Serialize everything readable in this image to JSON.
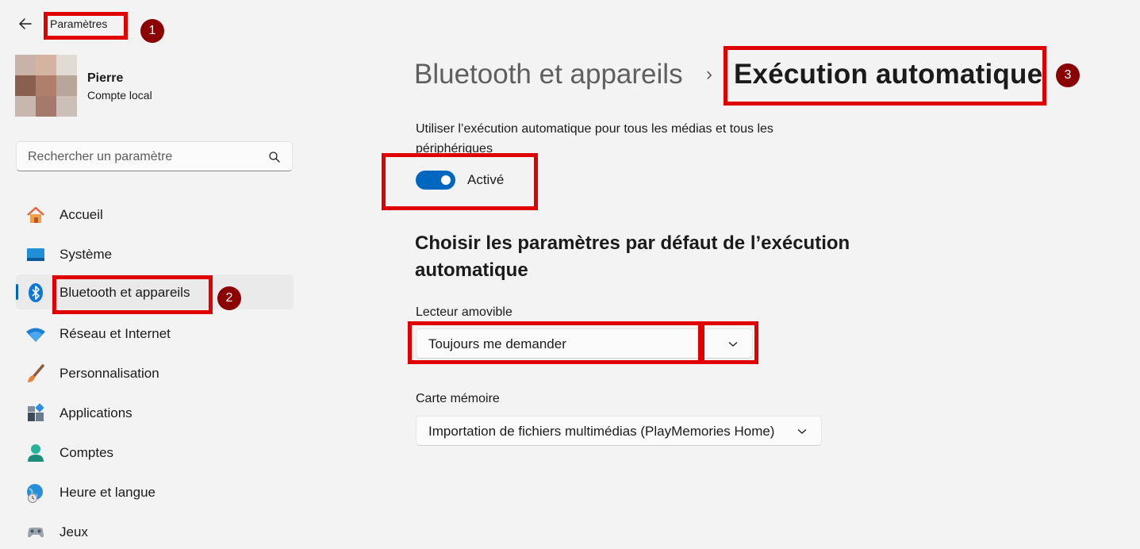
{
  "header": {
    "app_title": "Paramètres"
  },
  "user": {
    "name": "Pierre",
    "account_type": "Compte local"
  },
  "search": {
    "placeholder": "Rechercher un paramètre"
  },
  "sidebar": {
    "items": [
      {
        "label": "Accueil",
        "icon": "home-icon"
      },
      {
        "label": "Système",
        "icon": "system-icon"
      },
      {
        "label": "Bluetooth et appareils",
        "icon": "bluetooth-icon",
        "active": true
      },
      {
        "label": "Réseau et Internet",
        "icon": "wifi-icon"
      },
      {
        "label": "Personnalisation",
        "icon": "brush-icon"
      },
      {
        "label": "Applications",
        "icon": "apps-icon"
      },
      {
        "label": "Comptes",
        "icon": "person-icon"
      },
      {
        "label": "Heure et langue",
        "icon": "globe-clock-icon"
      },
      {
        "label": "Jeux",
        "icon": "gamepad-icon"
      }
    ]
  },
  "breadcrumb": {
    "parent": "Bluetooth et appareils",
    "separator": "›",
    "current": "Exécution automatique"
  },
  "autoplay": {
    "description": "Utiliser l’exécution automatique pour tous les médias et tous les périphériques",
    "toggle_label": "Activé",
    "toggle_on": true
  },
  "defaults": {
    "heading": "Choisir les paramètres par défaut de l’exécution automatique",
    "removable_label": "Lecteur amovible",
    "removable_value": "Toujours me demander",
    "memory_label": "Carte mémoire",
    "memory_value": "Importation de fichiers multimédias (PlayMemories Home)"
  },
  "annotations": {
    "marker1": "1",
    "marker2": "2",
    "marker3": "3"
  },
  "colors": {
    "accent": "#0067c0",
    "annotation_red": "#e00000",
    "marker": "#8b0000"
  }
}
